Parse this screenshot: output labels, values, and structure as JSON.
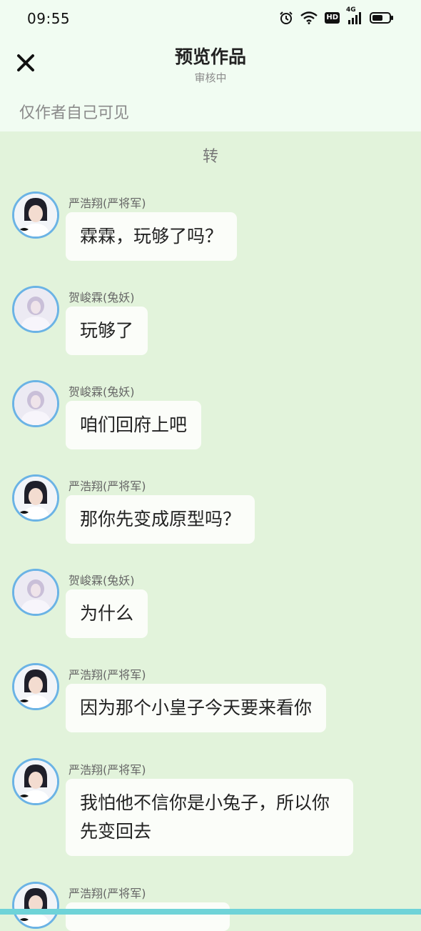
{
  "status_bar": {
    "time": "09:55",
    "network": "4G",
    "hd_label": "HD"
  },
  "header": {
    "title": "预览作品",
    "subtitle": "审核中"
  },
  "visibility_note": "仅作者自己可见",
  "chat": {
    "divider": "转",
    "messages": [
      {
        "sender": "严浩翔(严将军)",
        "text": "霖霖，玩够了吗？",
        "avatar": "avatar-yan"
      },
      {
        "sender": "贺峻霖(兔妖)",
        "text": "玩够了",
        "avatar": "avatar-he"
      },
      {
        "sender": "贺峻霖(兔妖)",
        "text": "咱们回府上吧",
        "avatar": "avatar-he"
      },
      {
        "sender": "严浩翔(严将军)",
        "text": "那你先变成原型吗？",
        "avatar": "avatar-yan"
      },
      {
        "sender": "贺峻霖(兔妖)",
        "text": "为什么",
        "avatar": "avatar-he"
      },
      {
        "sender": "严浩翔(严将军)",
        "text": "因为那个小皇子今天要来看你",
        "avatar": "avatar-yan"
      },
      {
        "sender": "严浩翔(严将军)",
        "text": "我怕他不信你是小兔子，所以你先变回去",
        "avatar": "avatar-yan"
      },
      {
        "sender": "严浩翔(严将军)",
        "text": "",
        "avatar": "avatar-yan"
      }
    ]
  },
  "colors": {
    "header_bg": "#f1fcf2",
    "chat_bg": "#e2f3db",
    "bubble_bg": "#fbfdf9",
    "avatar_ring": "#6bb3e5",
    "bottom_bar": "#6fd3d8"
  },
  "icons": [
    "alarm-icon",
    "wifi-icon",
    "hd-icon",
    "signal-4g-icon",
    "battery-icon",
    "close-icon"
  ]
}
